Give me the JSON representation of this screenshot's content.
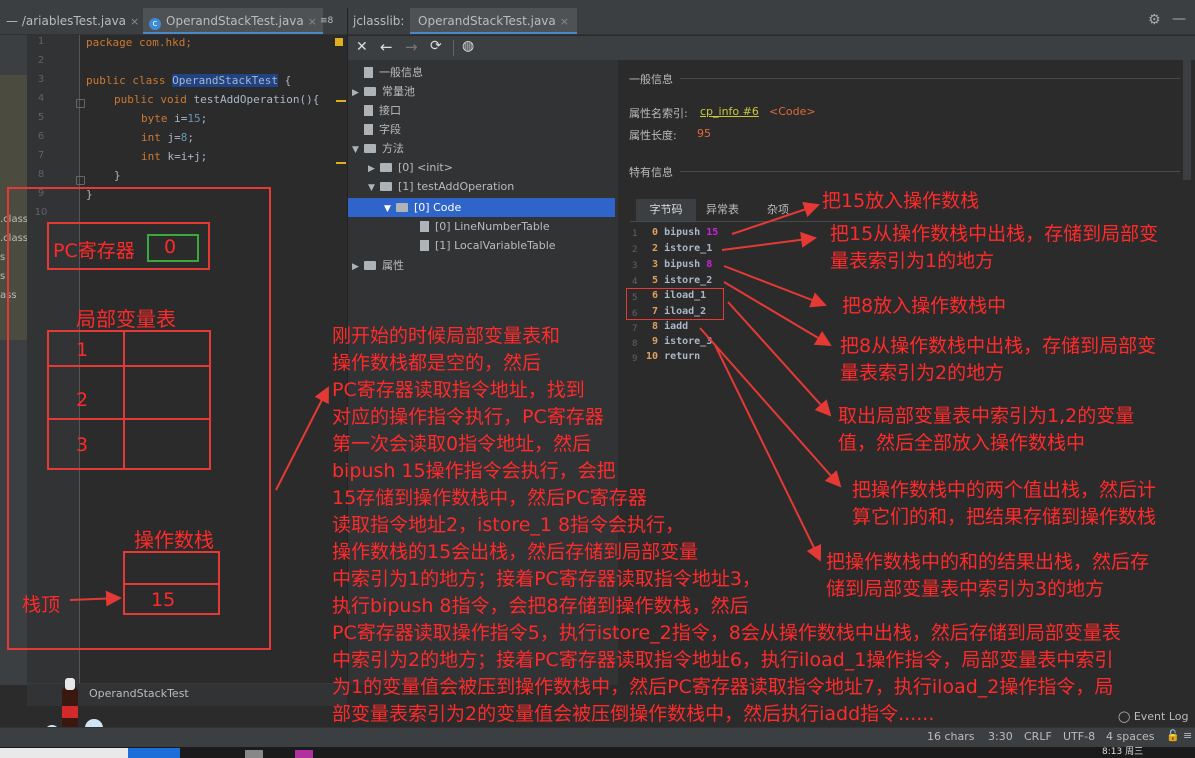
{
  "editor": {
    "tabs": [
      {
        "label": "VariablesTest.java",
        "shown": "/ariablesTest.java"
      },
      {
        "label": "OperandStackTest.java"
      }
    ],
    "tab_overflow": "≡8",
    "lines": [
      "1",
      "2",
      "3",
      "4",
      "5",
      "6",
      "7",
      "8",
      "9",
      "10"
    ],
    "code": {
      "l1": "package com.hkd;",
      "l3_kw": "public class ",
      "l3_name": "OperandStackTest",
      "l3_rest": " {",
      "l4_kw": "public void ",
      "l4_rest": "testAddOperation(){",
      "l5_kw": "byte ",
      "l5_a": "i=",
      "l5_num": "15",
      "l5_b": ";",
      "l6_kw": "int ",
      "l6_a": "j=",
      "l6_num": "8",
      "l6_b": ";",
      "l7_kw": "int ",
      "l7_a": "k=i+j;",
      "l8": "}",
      "l9": "}"
    },
    "left_files": [
      ".class",
      ".class",
      "s",
      "s",
      "ass"
    ],
    "breadcrumb": "OperandStackTest"
  },
  "jclasslib": {
    "tab_label": "jclasslib:",
    "file_tab": "OperandStackTest.java",
    "toolbar": [
      "close-icon",
      "back-icon",
      "forward-icon",
      "refresh-icon",
      "web-icon"
    ],
    "tree": [
      {
        "label": "一般信息"
      },
      {
        "label": "常量池"
      },
      {
        "label": "接口"
      },
      {
        "label": "字段"
      },
      {
        "label": "方法"
      },
      {
        "label": "[0] <init>"
      },
      {
        "label": "[1] testAddOperation"
      },
      {
        "label": "[0] Code"
      },
      {
        "label": "[0] LineNumberTable"
      },
      {
        "label": "[1] LocalVariableTable"
      },
      {
        "label": "属性"
      }
    ],
    "general_info": {
      "heading": "一般信息",
      "name_index_label": "属性名索引:",
      "name_index_link": "cp_info #6",
      "name_index_value": "<Code>",
      "length_label": "属性长度:",
      "length_value": "95"
    },
    "specific_heading": "特有信息",
    "sub_tabs": [
      "字节码",
      "异常表",
      "杂项"
    ],
    "bytecode": [
      {
        "n": "1",
        "off": "0",
        "op": "bipush",
        "arg": "15"
      },
      {
        "n": "2",
        "off": "2",
        "op": "istore_1",
        "arg": ""
      },
      {
        "n": "3",
        "off": "3",
        "op": "bipush",
        "arg": "8"
      },
      {
        "n": "4",
        "off": "5",
        "op": "istore_2",
        "arg": ""
      },
      {
        "n": "5",
        "off": "6",
        "op": "iload_1",
        "arg": ""
      },
      {
        "n": "6",
        "off": "7",
        "op": "iload_2",
        "arg": ""
      },
      {
        "n": "7",
        "off": "8",
        "op": "iadd",
        "arg": ""
      },
      {
        "n": "8",
        "off": "9",
        "op": "istore_3",
        "arg": ""
      },
      {
        "n": "9",
        "off": "10",
        "op": "return",
        "arg": ""
      }
    ]
  },
  "diagram": {
    "pc_label": "PC寄存器",
    "pc_value": "0",
    "locals_title": "局部变量表",
    "locals_rows": [
      "1",
      "2",
      "3"
    ],
    "stack_title": "操作数栈",
    "stack_value": "15",
    "stack_top_label": "栈顶"
  },
  "annotations": {
    "a1": "把15放入操作数栈",
    "a2": [
      "把15从操作数栈中出栈，存储到局部变",
      "量表索引为1的地方"
    ],
    "a3": "把8放入操作数栈中",
    "a4": [
      "把8从操作数栈中出栈，存储到局部变",
      "量表索引为2的地方"
    ],
    "a5": [
      "取出局部变量表中索引为1,2的变量",
      "值，然后全部放入操作数栈中"
    ],
    "a6": [
      "把操作数栈中的两个值出栈，然后计",
      "算它们的和，把结果存储到操作数栈"
    ],
    "a7": [
      "把操作数栈中的和的结果出栈，然后存",
      "储到局部变量表中索引为3的地方"
    ],
    "explain": [
      "刚开始的时候局部变量表和",
      "操作数栈都是空的，然后",
      "PC寄存器读取指令地址，找到",
      "对应的操作指令执行，PC寄存器",
      "第一次会读取0指令地址，然后",
      "bipush 15操作指令会执行，会把",
      "15存储到操作数栈中，然后PC寄存器",
      "读取指令地址2，istore_1 8指令会执行，",
      "操作数栈的15会出栈，然后存储到局部变量",
      "中索引为1的地方；接着PC寄存器读取指令地址3，",
      "执行bipush 8指令，会把8存储到操作数栈，然后",
      "PC寄存器读取操作指令5，执行istore_2指令，8会从操作数栈中出栈，然后存储到局部变量表",
      "中索引为2的地方；接着PC寄存器读取指令地址6，执行iload_1操作指令，局部变量表中索引",
      "为1的变量值会被压到操作数栈中，然后PC寄存器读取指令地址7，执行iload_2操作指令，局",
      "部变量表索引为2的变量值会被压倒操作数栈中，然后执行iadd指令......"
    ]
  },
  "status": {
    "event_log": "Event Log",
    "chars": "16 chars",
    "pos": "3:30",
    "crlf": "CRLF",
    "enc": "UTF-8",
    "indent": "4 spaces",
    "clock": "8:13 周三"
  }
}
